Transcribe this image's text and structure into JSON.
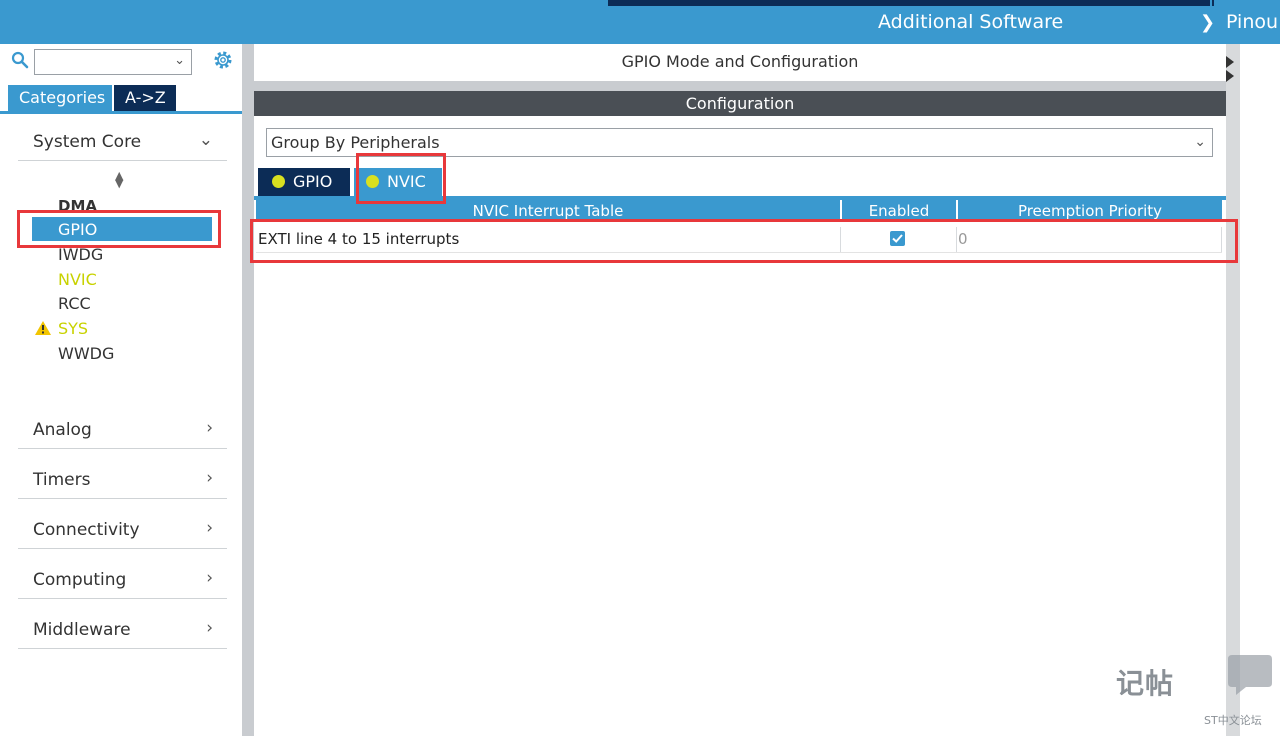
{
  "topbar": {
    "additional_software": "Additional Software",
    "pinout": "Pinou"
  },
  "sidebar": {
    "search_placeholder": "",
    "tabs": {
      "categories": "Categories",
      "az": "A->Z"
    },
    "categories": [
      {
        "label": "System Core",
        "expanded": true
      },
      {
        "label": "Analog",
        "expanded": false
      },
      {
        "label": "Timers",
        "expanded": false
      },
      {
        "label": "Connectivity",
        "expanded": false
      },
      {
        "label": "Computing",
        "expanded": false
      },
      {
        "label": "Middleware",
        "expanded": false
      }
    ],
    "system_core_items": [
      "DMA",
      "GPIO",
      "IWDG",
      "NVIC",
      "RCC",
      "SYS",
      "WWDG"
    ],
    "selected_item": "GPIO"
  },
  "main": {
    "title": "GPIO Mode and Configuration",
    "config_header": "Configuration",
    "group_select": "Group By Peripherals",
    "tabs": [
      {
        "label": "GPIO",
        "active": false
      },
      {
        "label": "NVIC",
        "active": true
      }
    ],
    "table": {
      "columns": [
        "NVIC Interrupt Table",
        "Enabled",
        "Preemption Priority"
      ],
      "rows": [
        {
          "name": "EXTI line 4 to 15 interrupts",
          "enabled": true,
          "priority": "0"
        }
      ]
    }
  },
  "watermark": {
    "main": "记帖",
    "sub": "ST中文论坛"
  },
  "colors": {
    "accent": "#3a99cf",
    "navy": "#0c2c56",
    "highlight": "#e8383b",
    "warning_text": "#c8d200"
  }
}
